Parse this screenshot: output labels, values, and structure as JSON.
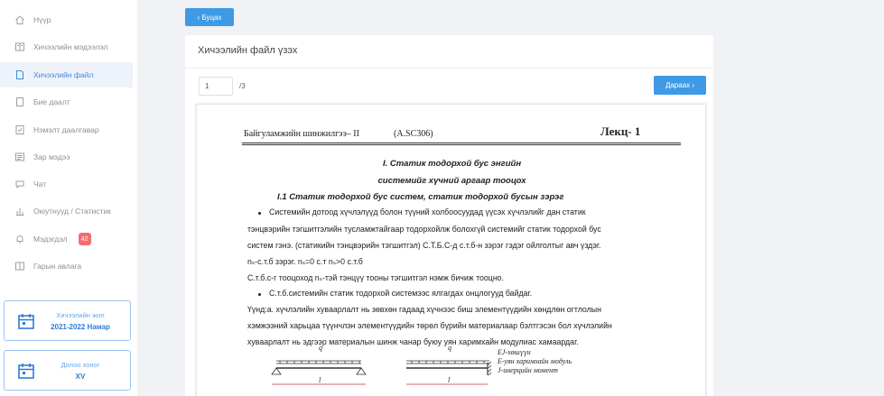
{
  "sidebar": {
    "items": [
      {
        "label": "Нүүр",
        "icon": "home-icon"
      },
      {
        "label": "Хичээлийн мэдээлэл",
        "icon": "book-icon"
      },
      {
        "label": "Хичээлийн файл",
        "icon": "file-icon",
        "active": true
      },
      {
        "label": "Бие даалт",
        "icon": "document-icon"
      },
      {
        "label": "Нэмэлт даалгавар",
        "icon": "checkbox-icon"
      },
      {
        "label": "Зар мэдээ",
        "icon": "newspaper-icon"
      },
      {
        "label": "Чат",
        "icon": "chat-icon"
      },
      {
        "label": "Оюутнууд / Статистик",
        "icon": "bar-chart-icon"
      },
      {
        "label": "Мэдэгдэл",
        "icon": "bell-icon",
        "badge": "42"
      },
      {
        "label": "Гарын авлага",
        "icon": "manual-icon"
      }
    ],
    "cards": [
      {
        "title": "Хичээлийн жил",
        "value": "2021-2022 Намар",
        "icon": "calendar-icon"
      },
      {
        "title": "Долоо хоног",
        "value": "XV",
        "icon": "calendar-icon"
      }
    ]
  },
  "toolbar": {
    "back_label": "‹ Буцах"
  },
  "card": {
    "title": "Хичээлийн файл үзэх",
    "page_value": "1",
    "page_total": "/3",
    "next_label": "Дараах ›"
  },
  "doc": {
    "course": "Байгуламжийн шинжилгээ– II",
    "code": "(A.SC306)",
    "lecture": "Лекц- 1",
    "heading1": "I. Статик тодорхой бус энгийн",
    "heading2": "системийг хүчний аргаар тооцох",
    "heading3": "I.1 Статик тодорхой бус систем, статик тодорхой бусын зэрэг",
    "bullet1_lines": [
      "Системийн дотоод хүчлэлүүд болон түүний холбоосуудад үүсэх хүчлэлийг дан статик",
      "тэнцвэрийн тэгшитгэлийн тусламжтайгаар тодорхойлж болохгүй системийг статик тодорхой бус",
      "систем гэнэ. (статикийн тэнцвэрийн тэгшитгэл) С.Т.Б.С-д с.т.б-н зэрэг гэдэг ойлголтыг авч үздэг.",
      "nₛ-с.т.б зэрэг. nₛ=0 с.т    nₛ>0 с.т.б",
      "С.т.б.с-г тооцоход nₛ-тэй тэнцүү тооны тэгшитгэл нэмж бичиж тооцно."
    ],
    "bullet2_lines": [
      "С.т.б.системийн статик тодорхой системээс ялгагдах онцлогууд байдаг.",
      "Үүнд:а.  хүчлэлийн хуваарлалт нь зөвхөн гадаад хүчнээс биш элементүүдийн хөндлөн огтлолын",
      "хэмжээний харьцаа түүнчлэн элементүүдийн төрөл бүрийн материалаар бэлтгэсэн бол хүчлэлийн",
      "хуваарлалт нь эдгээр материалын шинж чанар буюу уян харимхайн модулиас хамаардаг."
    ],
    "figure": {
      "load_label": "q",
      "span_label": "l",
      "legend": [
        "EJ-хөшүүн",
        "E-уян харимхайн модуль",
        "J-инерцийн момент"
      ]
    }
  }
}
